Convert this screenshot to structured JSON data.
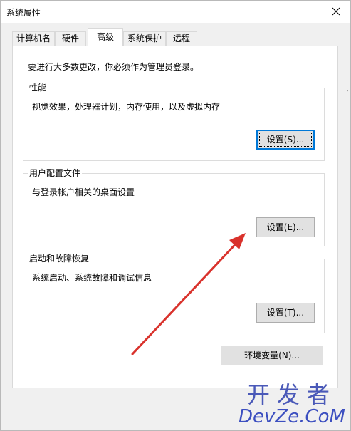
{
  "window": {
    "title": "系统属性"
  },
  "tabs": [
    {
      "label": "计算机名"
    },
    {
      "label": "硬件"
    },
    {
      "label": "高级"
    },
    {
      "label": "系统保护"
    },
    {
      "label": "远程"
    }
  ],
  "notice": "要进行大多数更改，你必须作为管理员登录。",
  "groups": {
    "performance": {
      "title": "性能",
      "description": "视觉效果，处理器计划，内存使用，以及虚拟内存",
      "button": "设置(S)..."
    },
    "user_profiles": {
      "title": "用户配置文件",
      "description": "与登录帐户相关的桌面设置",
      "button": "设置(E)..."
    },
    "startup_recovery": {
      "title": "启动和故障恢复",
      "description": "系统启动、系统故障和调试信息",
      "button": "设置(T)..."
    }
  },
  "env_button": "环境变量(N)...",
  "watermark": {
    "top": "开发者",
    "bottom": "DevZe.CoM"
  },
  "background": {
    "side_char": "r"
  },
  "colors": {
    "arrow": "#d9322c",
    "focus": "#0078d7",
    "watermark": "#4a59b8"
  }
}
